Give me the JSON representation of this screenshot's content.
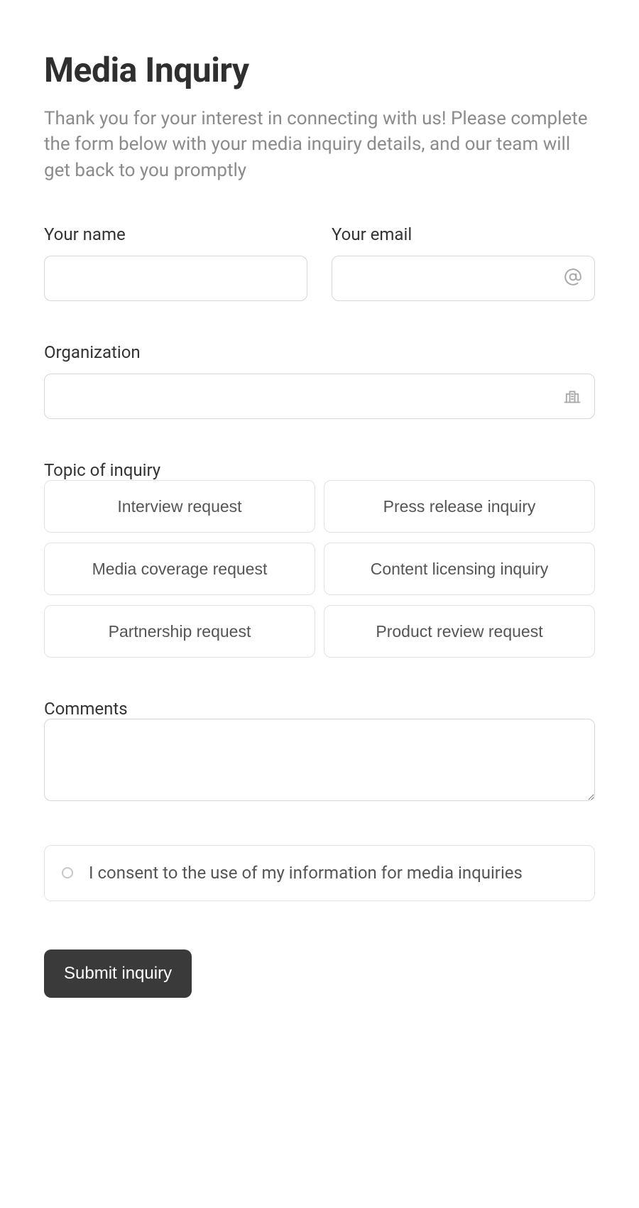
{
  "header": {
    "title": "Media Inquiry",
    "description": "Thank you for your interest in connecting with us! Please complete the form below with your media inquiry details, and our team will get back to you promptly"
  },
  "fields": {
    "name": {
      "label": "Your name",
      "value": ""
    },
    "email": {
      "label": "Your email",
      "value": ""
    },
    "organization": {
      "label": "Organization",
      "value": ""
    },
    "topic": {
      "label": "Topic of inquiry",
      "options": [
        "Interview request",
        "Press release inquiry",
        "Media coverage request",
        "Content licensing inquiry",
        "Partnership request",
        "Product review request"
      ]
    },
    "comments": {
      "label": "Comments",
      "value": ""
    },
    "consent": {
      "label": "I consent to the use of my information for media inquiries",
      "checked": false
    }
  },
  "actions": {
    "submit_label": "Submit inquiry"
  }
}
